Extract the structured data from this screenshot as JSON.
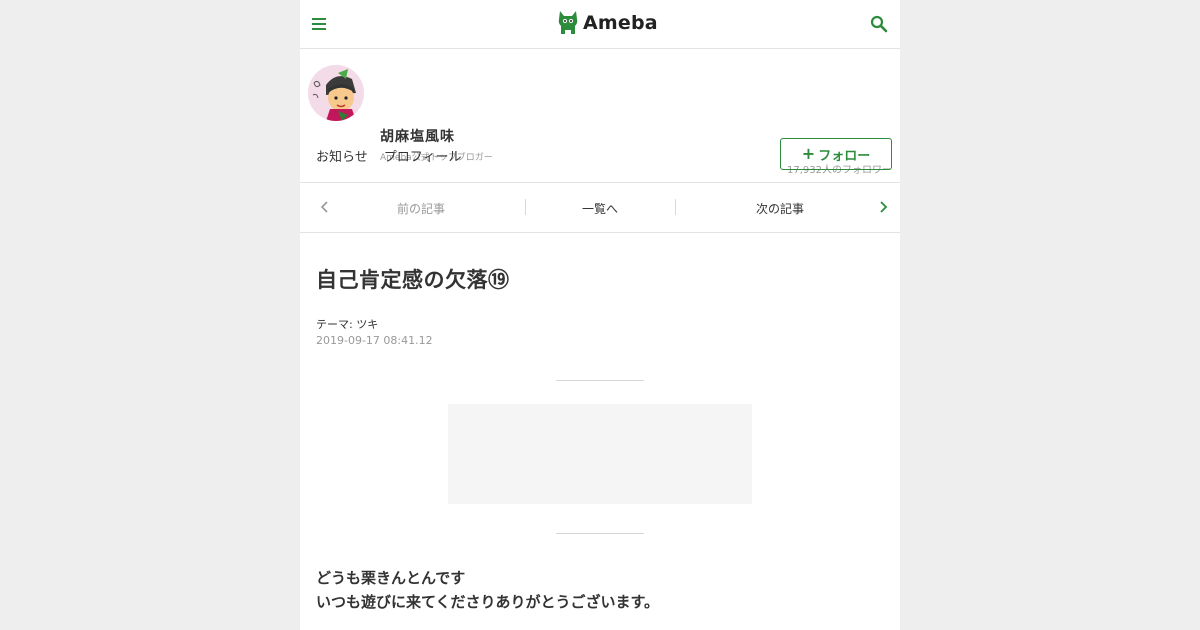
{
  "header": {
    "logo_text": "Ameba"
  },
  "profile": {
    "blogger_name": "胡麻塩風味",
    "badge": "Ameba公式トップブロガー",
    "followers": "17,932人のフォロワー",
    "links": [
      "お知らせ",
      "プロフィール"
    ],
    "follow_label": "フォロー"
  },
  "article_nav": {
    "prev": "前の記事",
    "list": "一覧へ",
    "next": "次の記事"
  },
  "entry": {
    "title": "自己肯定感の欠落⑲",
    "theme_label": "テーマ:",
    "theme_value": "ツキ",
    "date": "2019-09-17 08:41.12",
    "body_lines": [
      "どうも栗きんとんです",
      "いつも遊びに来てくださりありがとうございます。"
    ]
  },
  "colors": {
    "accent": "#2d8c3c",
    "page_bg": "#eeeeee",
    "muted_text": "#999999"
  }
}
